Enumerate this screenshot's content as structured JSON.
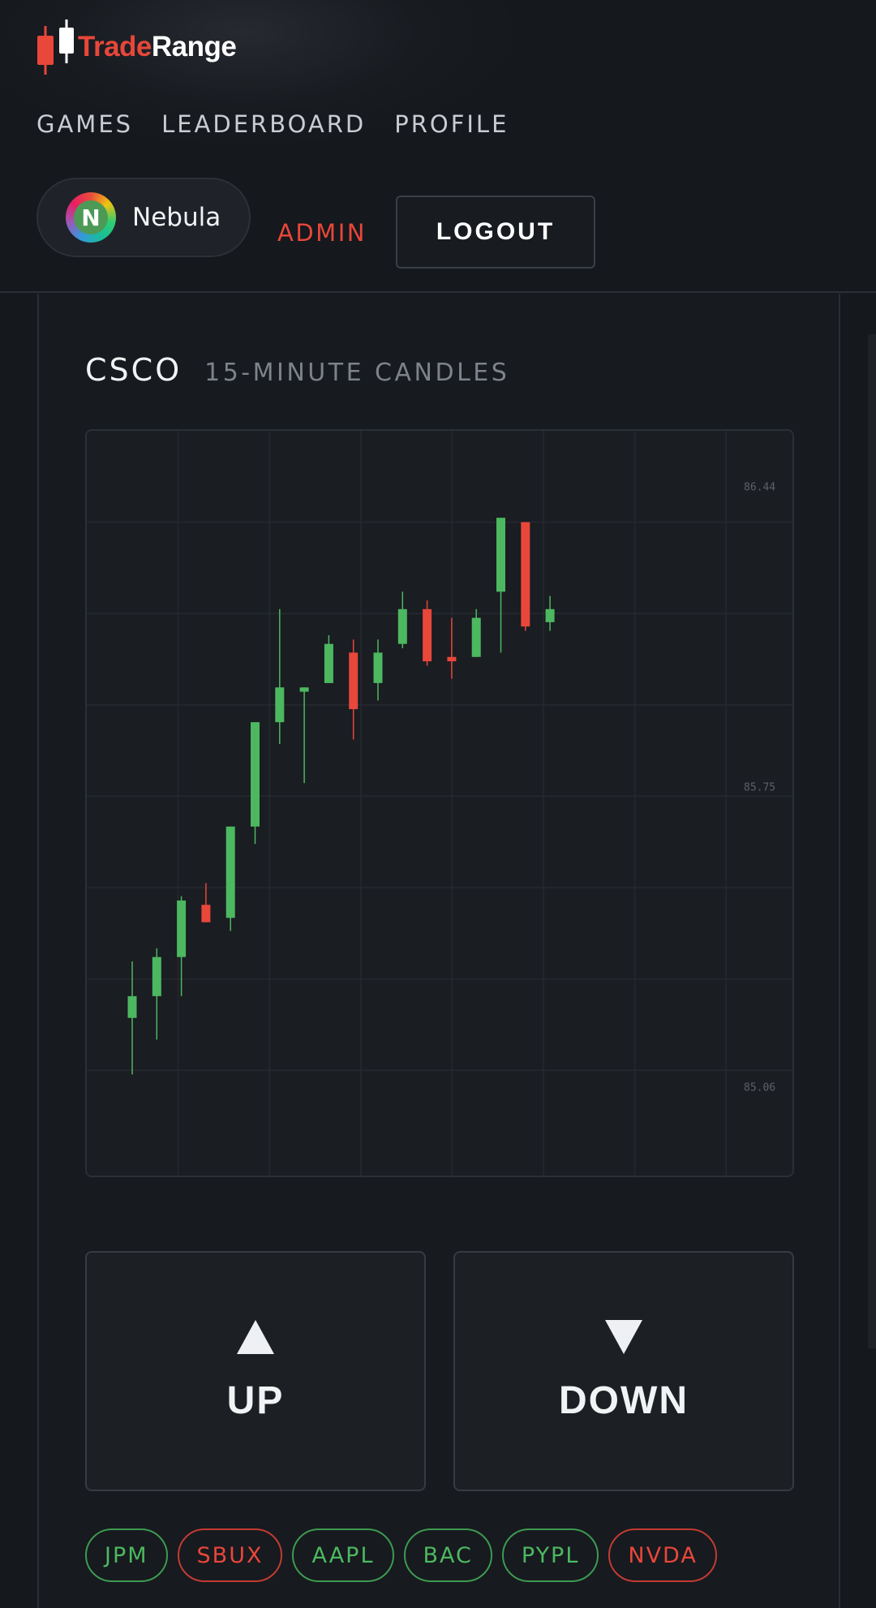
{
  "brand": {
    "name_part1": "Trade",
    "name_part2": "Range",
    "accent": "#e8473a"
  },
  "nav": {
    "items": [
      "GAMES",
      "LEADERBOARD",
      "PROFILE"
    ]
  },
  "user": {
    "name": "Nebula",
    "avatar_letter": "N"
  },
  "admin_label": "ADMIN",
  "logout_label": "LOGOUT",
  "chart": {
    "ticker": "CSCO",
    "timeframe": "15-MINUTE CANDLES",
    "price_labels": [
      "86.44",
      "85.75",
      "85.06"
    ]
  },
  "chart_data": {
    "type": "candlestick",
    "title": "CSCO",
    "subtitle": "15-MINUTE CANDLES",
    "ylim": [
      84.85,
      86.57
    ],
    "yticks": [
      86.44,
      85.75,
      85.06
    ],
    "grid": true,
    "candles": [
      {
        "o": 85.22,
        "h": 85.35,
        "l": 85.09,
        "c": 85.27
      },
      {
        "o": 85.27,
        "h": 85.38,
        "l": 85.17,
        "c": 85.36
      },
      {
        "o": 85.36,
        "h": 85.5,
        "l": 85.27,
        "c": 85.49
      },
      {
        "o": 85.48,
        "h": 85.53,
        "l": 85.44,
        "c": 85.44
      },
      {
        "o": 85.45,
        "h": 85.6,
        "l": 85.42,
        "c": 85.66
      },
      {
        "o": 85.66,
        "h": 85.9,
        "l": 85.62,
        "c": 85.9
      },
      {
        "o": 85.9,
        "h": 86.16,
        "l": 85.85,
        "c": 85.98
      },
      {
        "o": 85.97,
        "h": 85.98,
        "l": 85.76,
        "c": 85.98
      },
      {
        "o": 85.99,
        "h": 86.1,
        "l": 85.99,
        "c": 86.08
      },
      {
        "o": 86.06,
        "h": 86.09,
        "l": 85.86,
        "c": 85.93
      },
      {
        "o": 85.99,
        "h": 86.09,
        "l": 85.95,
        "c": 86.06
      },
      {
        "o": 86.08,
        "h": 86.2,
        "l": 86.07,
        "c": 86.16
      },
      {
        "o": 86.16,
        "h": 86.18,
        "l": 86.03,
        "c": 86.04
      },
      {
        "o": 86.05,
        "h": 86.14,
        "l": 86.0,
        "c": 86.04
      },
      {
        "o": 86.05,
        "h": 86.16,
        "l": 86.05,
        "c": 86.14
      },
      {
        "o": 86.2,
        "h": 86.35,
        "l": 86.06,
        "c": 86.37
      },
      {
        "o": 86.36,
        "h": 86.3,
        "l": 86.11,
        "c": 86.12
      },
      {
        "o": 86.13,
        "h": 86.19,
        "l": 86.11,
        "c": 86.16
      }
    ],
    "colors": {
      "up": "#4cb860",
      "down": "#e8473a"
    }
  },
  "vote": {
    "up_label": "UP",
    "down_label": "DOWN"
  },
  "ticker_chips": [
    {
      "label": "JPM",
      "dir": "up"
    },
    {
      "label": "SBUX",
      "dir": "down"
    },
    {
      "label": "AAPL",
      "dir": "up"
    },
    {
      "label": "BAC",
      "dir": "up"
    },
    {
      "label": "PYPL",
      "dir": "up"
    },
    {
      "label": "NVDA",
      "dir": "down"
    }
  ]
}
